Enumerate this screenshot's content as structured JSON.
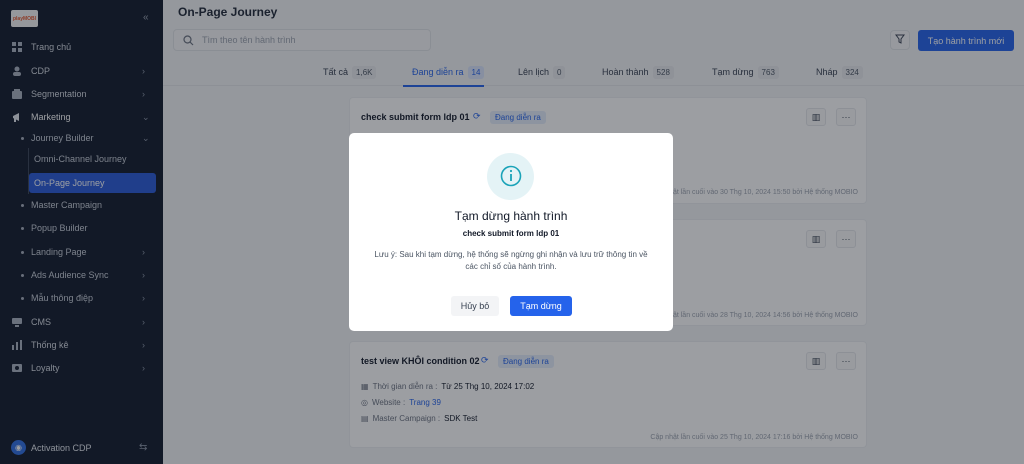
{
  "sidebar": {
    "logo_text": "playMOBI",
    "items": [
      {
        "label": "Trang chủ",
        "icon": "home-icon"
      },
      {
        "label": "CDP",
        "icon": "user-icon"
      },
      {
        "label": "Segmentation",
        "icon": "segment-icon"
      },
      {
        "label": "Marketing",
        "icon": "megaphone-icon"
      },
      {
        "label": "CMS",
        "icon": "cms-icon"
      },
      {
        "label": "Thống kê",
        "icon": "chart-icon"
      },
      {
        "label": "Loyalty",
        "icon": "loyalty-icon"
      }
    ],
    "marketing_children": [
      {
        "label": "Journey Builder"
      },
      {
        "label": "Master Campaign"
      },
      {
        "label": "Popup Builder"
      },
      {
        "label": "Landing Page"
      },
      {
        "label": "Ads Audience Sync"
      },
      {
        "label": "Mẫu thông điệp"
      }
    ],
    "journey_children": [
      {
        "label": "Omni-Channel Journey",
        "active": false
      },
      {
        "label": "On-Page Journey",
        "active": true
      }
    ],
    "footer_label": "Activation CDP"
  },
  "header": {
    "title": "On-Page Journey",
    "search_placeholder": "Tìm theo tên hành trình",
    "create_button": "Tạo hành trình mới"
  },
  "tabs": [
    {
      "label": "Tất cả",
      "count": "1,6K"
    },
    {
      "label": "Đang diễn ra",
      "count": "14",
      "active": true
    },
    {
      "label": "Lên lịch",
      "count": "0"
    },
    {
      "label": "Hoàn thành",
      "count": "528"
    },
    {
      "label": "Tạm dừng",
      "count": "763"
    },
    {
      "label": "Nháp",
      "count": "324"
    }
  ],
  "cards": [
    {
      "title": "check submit form ldp 01",
      "status": "Đang diễn ra",
      "updated": "Cập nhật lần cuối vào 30 Thg 10, 2024 15:50 bởi Hệ thống MOBIO"
    },
    {
      "title": "",
      "status": "",
      "updated": "Cập nhật lần cuối vào 28 Thg 10, 2024 14:56 bởi Hệ thống MOBIO"
    },
    {
      "title": "test view KHÔI condition 02",
      "status": "Đang diễn ra",
      "meta_time_label": "Thời gian diễn ra :",
      "meta_time_value": "Từ 25 Thg 10, 2024 17:02",
      "meta_web_label": "Website :",
      "meta_web_value": "Trang 39",
      "meta_mc_label": "Master Campaign :",
      "meta_mc_value": "SDK Test",
      "updated": "Cập nhật lần cuối vào 25 Thg 10, 2024 17:16 bởi Hệ thống MOBIO"
    }
  ],
  "modal": {
    "title": "Tạm dừng hành trình",
    "subtitle": "check submit form ldp 01",
    "body": "Lưu ý: Sau khi tạm dừng, hệ thống sẽ ngừng ghi nhận và lưu trữ thông tin về các chỉ số của hành trình.",
    "cancel_label": "Hủy bỏ",
    "confirm_label": "Tạm dừng"
  },
  "colors": {
    "accent": "#2563eb",
    "sidebar_bg": "#121b2c"
  }
}
